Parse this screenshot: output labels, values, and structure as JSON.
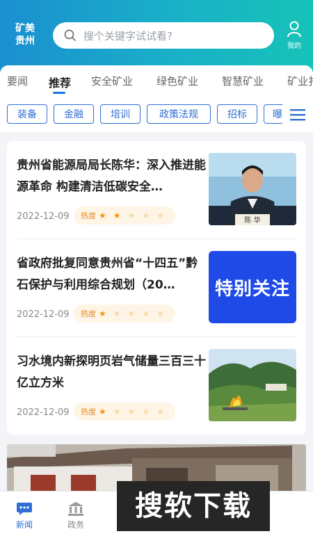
{
  "header": {
    "logo_line1": "矿美",
    "logo_line2": "贵州",
    "search_placeholder": "搜个关键字试试看?",
    "me_label": "我的"
  },
  "tabs": [
    {
      "label": "要闻"
    },
    {
      "label": "推荐"
    },
    {
      "label": "安全矿业"
    },
    {
      "label": "绿色矿业"
    },
    {
      "label": "智慧矿业"
    },
    {
      "label": "矿业扌"
    }
  ],
  "chips": [
    {
      "label": "装备"
    },
    {
      "label": "金融"
    },
    {
      "label": "培训"
    },
    {
      "label": "政策法规"
    },
    {
      "label": "招标"
    },
    {
      "label": "曝"
    }
  ],
  "articles": [
    {
      "title": "贵州省能源局局长陈华：深入推进能源革命 构建清洁低碳安全…",
      "date": "2022-12-09",
      "heat_label": "热度",
      "rating": 2
    },
    {
      "title": "省政府批复同意贵州省“十四五”黔石保护与利用综合规划（20…",
      "date": "2022-12-09",
      "heat_label": "热度",
      "rating": 1,
      "thumb_text": "特别关注"
    },
    {
      "title": "习水境内新探明页岩气储量三百三十亿立方米",
      "date": "2022-12-09",
      "heat_label": "热度",
      "rating": 1
    }
  ],
  "thumb1_caption": "陈 华",
  "bottom_nav": [
    {
      "label": "新闻"
    },
    {
      "label": "政务"
    }
  ],
  "watermark": "搜软下载",
  "colors": {
    "accent": "#2f6fd6",
    "star_on": "#f0950f",
    "star_off": "#f7d9a8"
  }
}
